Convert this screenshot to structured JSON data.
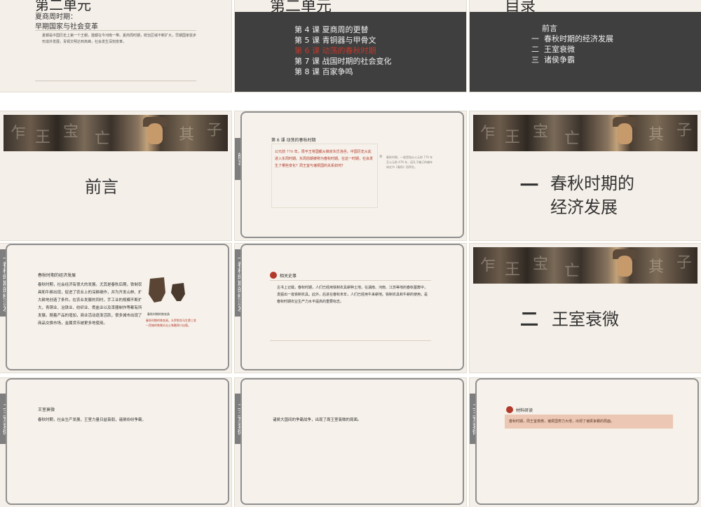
{
  "slides": {
    "s1": {
      "title": "第二单元",
      "subtitle1": "夏商周时期：",
      "subtitle2": "早期国家与社会变革",
      "body": "夏朝是中国历史上第一个王朝，建都在今河南一带。夏商周时期，统治区域不断扩大，早期国家逐步形成并发展，青铜文明达到高峰，社会发生深刻变革。"
    },
    "s2": {
      "title": "第二单元",
      "lessons": [
        "第 4 课  夏商周的更替",
        "第 5 课  青铜器与甲骨文",
        "第 6 课  动荡的春秋时期",
        "第 7 课  战国时期的社会变化",
        "第 8 课  百家争鸣"
      ],
      "highlight_color": "#c0392b"
    },
    "s3": {
      "title": "目录",
      "items": [
        {
          "num": "",
          "text": "前言"
        },
        {
          "num": "一",
          "text": "春秋时期的经济发展"
        },
        {
          "num": "二",
          "text": "王室衰微"
        },
        {
          "num": "三",
          "text": "诸侯争霸"
        }
      ]
    },
    "s4": {
      "title": "前言"
    },
    "s5": {
      "tab": "前言",
      "heading": "第 6 课 动荡的春秋时期",
      "quote": "公元前 770 年，周平王将国都从镐京东迁洛邑。中国历史从此进入东周时期。东周前期被称为春秋时期。在这一时期，社会发生了哪些变化？周王室与诸侯国的关系如何？",
      "note": "春秋时期，一般是指从公元前 770 年至公元前 476 年，因孔子编订的编年体史书《春秋》而得名。",
      "note_marker": "①"
    },
    "s6": {
      "num": "一",
      "title1": "春秋时期的",
      "title2": "经济发展"
    },
    "s7": {
      "tab": "一春秋时期的经济发展",
      "heading": "春秋时期的经济发展",
      "body": "春秋时期，社会经济有很大的发展。尤其是春秋后期，铁制农具和牛耕出现，促进了农业上的深耕细作，并为开发山林、扩大耕地创造了条件。在农业发展的同时，手工业的规模不断扩大，青铜业、冶铁业、纺织业、煮盐业以及漆器制作等都有所发展。随着产品的增加，商业活动逐渐活跃，很多城市出现了商品交换市场，金属货币被更多地使用。",
      "img_label": "春秋时期的铁农具",
      "img_caption": "春秋时期的铁农具。头罗斯克马生第三发一西城的铁锄头出土铁雕耳口出版。"
    },
    "s8": {
      "tab": "一春秋时期的经济发展",
      "heading": "相关史事",
      "body": "古书上记载，春秋时期，人们已经用铁制农具耕种土地。在湖南、河南、江苏等地的春秋墓葬中，发掘出一批铁制农具。此外，后进在春秋末年，人们已经用牛来耕地。铁制农具和牛耕的使用，是春秋时期农业生产力水平提高的重要标志。"
    },
    "s9": {
      "num": "二",
      "title": "王室衰微"
    },
    "s10": {
      "tab": "二王室衰微",
      "heading": "王室衰微",
      "body": "春秋时期，社会生产发展，王室力量日益衰弱，诸侯纷纷争霸，"
    },
    "s11": {
      "tab": "二王室衰微",
      "body": "诸侯大国间的争霸战争，出现了周王室衰微的局面。"
    },
    "s12": {
      "tab": "二王室衰微",
      "heading": "材料研读",
      "body": "春秋时期，周王室衰微，诸侯国势力大增，出现了诸侯争霸的局面。"
    }
  }
}
